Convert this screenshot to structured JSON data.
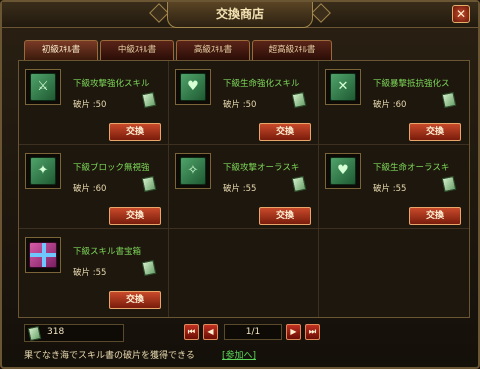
{
  "window": {
    "title": "交換商店",
    "close_label": "✕"
  },
  "tabs": [
    {
      "label": "初級ｽｷﾙ書",
      "active": true
    },
    {
      "label": "中級ｽｷﾙ書",
      "active": false
    },
    {
      "label": "高級ｽｷﾙ書",
      "active": false
    },
    {
      "label": "超高級ｽｷﾙ書",
      "active": false
    }
  ],
  "items": [
    {
      "name": "下級攻撃強化スキル",
      "fragments": "破片 :50",
      "button": "交換",
      "icon": "sword-book-icon",
      "glyph": "⚔"
    },
    {
      "name": "下級生命強化スキル",
      "fragments": "破片 :50",
      "button": "交換",
      "icon": "heart-book-icon",
      "glyph": "♥"
    },
    {
      "name": "下級暴撃抵抗強化ス",
      "fragments": "破片 :60",
      "button": "交換",
      "icon": "cross-book-icon",
      "glyph": "✕"
    },
    {
      "name": "下級ブロック無視強",
      "fragments": "破片 :60",
      "button": "交換",
      "icon": "shield-book-icon",
      "glyph": "✦"
    },
    {
      "name": "下級攻撃オーラスキ",
      "fragments": "破片 :55",
      "button": "交換",
      "icon": "aura-sword-book-icon",
      "glyph": "✧"
    },
    {
      "name": "下級生命オーラスキ",
      "fragments": "破片 :55",
      "button": "交換",
      "icon": "aura-heart-book-icon",
      "glyph": "♥"
    },
    {
      "name": "下級スキル書宝箱",
      "fragments": "破片 :55",
      "button": "交換",
      "icon": "treasure-box-icon",
      "glyph": ""
    }
  ],
  "bottom": {
    "total_fragments": "318",
    "page": "1/1",
    "first": "⏮",
    "prev": "◀",
    "next": "▶",
    "last": "⏭"
  },
  "footer": {
    "hint": "果てなき海でスキル書の破片を獲得できる",
    "join_link": "[参加へ]"
  }
}
